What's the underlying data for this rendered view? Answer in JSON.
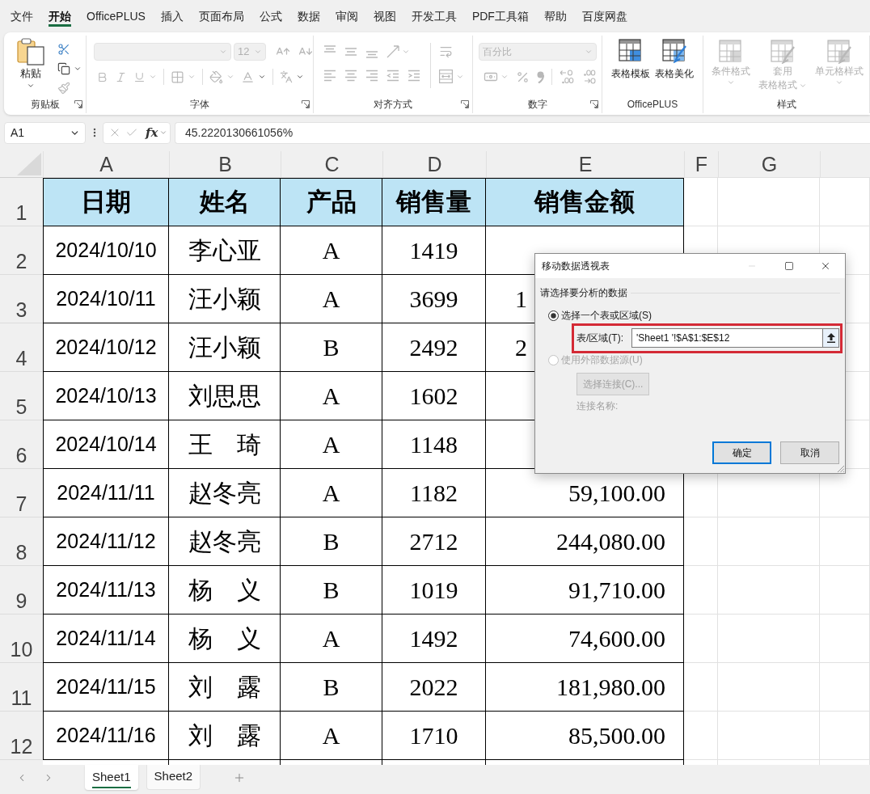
{
  "menu_tabs": [
    {
      "label": "文件",
      "selected": false
    },
    {
      "label": "开始",
      "selected": true
    },
    {
      "label": "OfficePLUS",
      "selected": false
    },
    {
      "label": "插入",
      "selected": false
    },
    {
      "label": "页面布局",
      "selected": false
    },
    {
      "label": "公式",
      "selected": false
    },
    {
      "label": "数据",
      "selected": false
    },
    {
      "label": "审阅",
      "selected": false
    },
    {
      "label": "视图",
      "selected": false
    },
    {
      "label": "开发工具",
      "selected": false
    },
    {
      "label": "PDF工具箱",
      "selected": false
    },
    {
      "label": "帮助",
      "selected": false
    },
    {
      "label": "百度网盘",
      "selected": false
    }
  ],
  "ribbon": {
    "groups": [
      {
        "kind": "clipboard",
        "label": "剪贴板",
        "launcher": true,
        "paste_label": "粘贴"
      },
      {
        "kind": "font",
        "label": "字体",
        "launcher": true,
        "disabled": true,
        "font_size": "12"
      },
      {
        "kind": "alignment",
        "label": "对齐方式",
        "launcher": true,
        "disabled": true
      },
      {
        "kind": "number",
        "label": "数字",
        "launcher": true,
        "disabled": true,
        "number_format": "百分比"
      },
      {
        "kind": "officeplus",
        "label": "OfficePLUS",
        "buttons": [
          {
            "label": "表格模板"
          },
          {
            "label": "表格美化"
          }
        ]
      },
      {
        "kind": "styles",
        "label": "样式",
        "disabled": true,
        "buttons": [
          {
            "lines": [
              "条件格式"
            ]
          },
          {
            "lines": [
              "套用",
              "表格格式"
            ]
          },
          {
            "lines": [
              "单元格样式"
            ]
          }
        ]
      }
    ]
  },
  "formula_bar": {
    "name_box": "A1",
    "function_label": "fx",
    "value": "45.2220130661056%"
  },
  "sheet": {
    "columns": [
      "A",
      "B",
      "C",
      "D",
      "E",
      "F",
      "G"
    ],
    "row_numbers": [
      "1",
      "2",
      "3",
      "4",
      "5",
      "6",
      "7",
      "8",
      "9",
      "10",
      "11",
      "12"
    ],
    "table": {
      "header": [
        "日期",
        "姓名",
        "产品",
        "销售量",
        "销售金额"
      ],
      "rows": [
        {
          "date": "2024/10/10",
          "name": "李心亚",
          "product": "A",
          "quantity": "1419"
        },
        {
          "date": "2024/10/11",
          "name": "汪小颖",
          "product": "A",
          "quantity": "3699",
          "amount": "1",
          "amount_covered": true
        },
        {
          "date": "2024/10/12",
          "name": "汪小颖",
          "product": "B",
          "quantity": "2492",
          "amount": "2",
          "amount_covered": true
        },
        {
          "date": "2024/10/13",
          "name": "刘思思",
          "product": "A",
          "quantity": "1602"
        },
        {
          "date": "2024/10/14",
          "name": "王　琦",
          "product": "A",
          "quantity": "1148"
        },
        {
          "date": "2024/11/11",
          "name": "赵冬亮",
          "product": "A",
          "quantity": "1182",
          "amount": "59,100.00"
        },
        {
          "date": "2024/11/12",
          "name": "赵冬亮",
          "product": "B",
          "quantity": "2712",
          "amount": "244,080.00"
        },
        {
          "date": "2024/11/13",
          "name": "杨　义",
          "product": "B",
          "quantity": "1019",
          "amount": "91,710.00"
        },
        {
          "date": "2024/11/14",
          "name": "杨　义",
          "product": "A",
          "quantity": "1492",
          "amount": "74,600.00"
        },
        {
          "date": "2024/11/15",
          "name": "刘　露",
          "product": "B",
          "quantity": "2022",
          "amount": "181,980.00"
        },
        {
          "date": "2024/11/16",
          "name": "刘　露",
          "product": "A",
          "quantity": "1710",
          "amount": "85,500.00"
        }
      ]
    }
  },
  "sheet_tabs": [
    {
      "label": "Sheet1",
      "selected": true
    },
    {
      "label": "Sheet2",
      "selected": false
    }
  ],
  "dialog": {
    "title": "移动数据透视表",
    "section": "请选择要分析的数据",
    "options": [
      {
        "label": "选择一个表或区域(S)",
        "selected": true,
        "disabled": false
      },
      {
        "label": "使用外部数据源(U)",
        "selected": false,
        "disabled": true
      }
    ],
    "range_label": "表/区域(T):",
    "range_value": "'Sheet1 '!$A$1:$E$12",
    "connect_button": {
      "label": "选择连接(C)...",
      "disabled": true
    },
    "connection_label": "连接名称:",
    "buttons": [
      {
        "label": "确定",
        "default": true
      },
      {
        "label": "取消",
        "default": false
      }
    ]
  }
}
